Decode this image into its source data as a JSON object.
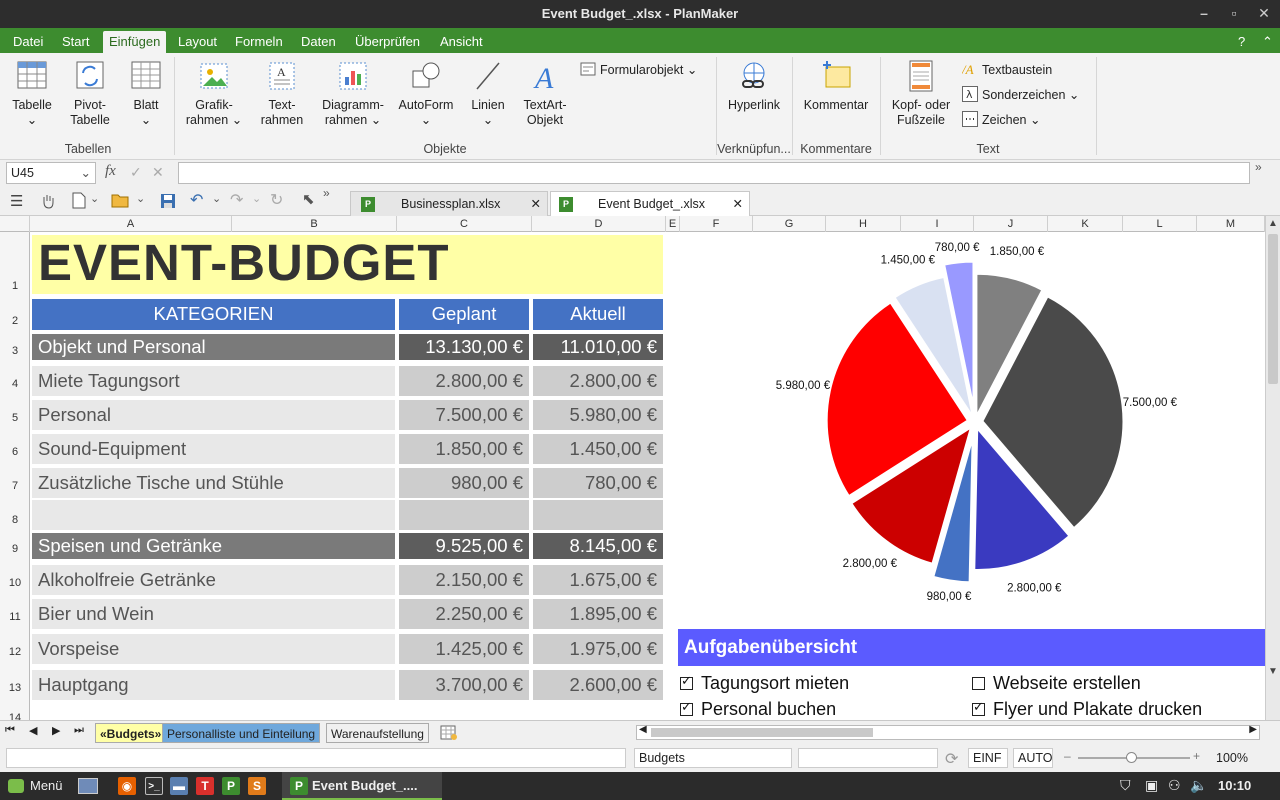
{
  "window": {
    "title": "Event Budget_.xlsx - PlanMaker"
  },
  "menu": {
    "tabs": [
      "Datei",
      "Start",
      "Einfügen",
      "Layout",
      "Formeln",
      "Daten",
      "Überprüfen",
      "Ansicht"
    ],
    "active": "Einfügen",
    "help": "?"
  },
  "ribbon": {
    "tabelle": "Tabelle",
    "pivot_1": "Pivot-",
    "pivot_2": "Tabelle",
    "blatt": "Blatt",
    "grafik_1": "Grafik-",
    "grafik_2": "rahmen",
    "text_1": "Text-",
    "text_2": "rahmen",
    "diagramm_1": "Diagramm-",
    "diagramm_2": "rahmen",
    "autoform": "AutoForm",
    "linien": "Linien",
    "textart_1": "TextArt-",
    "textart_2": "Objekt",
    "formularobjekt": "Formularobjekt",
    "hyperlink": "Hyperlink",
    "kommentar": "Kommentar",
    "kopf_1": "Kopf- oder",
    "kopf_2": "Fußzeile",
    "textbaustein": "Textbaustein",
    "sonderzeichen": "Sonderzeichen",
    "zeichen": "Zeichen",
    "groups": {
      "tabellen": "Tabellen",
      "objekte": "Objekte",
      "verknuepfungen": "Verknüpfun...",
      "kommentare": "Kommentare",
      "text": "Text"
    }
  },
  "formula_bar": {
    "cell_ref": "U45",
    "fx": "fx",
    "content": ""
  },
  "doc_tabs": [
    {
      "label": "Businessplan.xlsx"
    },
    {
      "label": "Event Budget_.xlsx"
    }
  ],
  "columns": [
    "A",
    "B",
    "C",
    "D",
    "E",
    "F",
    "G",
    "H",
    "I",
    "J",
    "K",
    "L",
    "M"
  ],
  "rows": [
    "1",
    "2",
    "3",
    "4",
    "5",
    "6",
    "7",
    "8",
    "9",
    "10",
    "11",
    "12",
    "13",
    "14"
  ],
  "sheet": {
    "title": "EVENT-BUDGET",
    "headers": {
      "kategorien": "KATEGORIEN",
      "geplant": "Geplant",
      "aktuell": "Aktuell"
    },
    "rows": [
      {
        "label": "Objekt und Personal",
        "geplant": "13.130,00 €",
        "aktuell": "11.010,00 €"
      },
      {
        "label": "Miete Tagungsort",
        "geplant": "2.800,00 €",
        "aktuell": "2.800,00 €"
      },
      {
        "label": "Personal",
        "geplant": "7.500,00 €",
        "aktuell": "5.980,00 €"
      },
      {
        "label": "Sound-Equipment",
        "geplant": "1.850,00 €",
        "aktuell": "1.450,00 €"
      },
      {
        "label": "Zusätzliche Tische und Stühle",
        "geplant": "980,00 €",
        "aktuell": "780,00 €"
      },
      {
        "label": "",
        "geplant": "",
        "aktuell": ""
      },
      {
        "label": "Speisen und Getränke",
        "geplant": "9.525,00 €",
        "aktuell": "8.145,00 €"
      },
      {
        "label": "Alkoholfreie Getränke",
        "geplant": "2.150,00 €",
        "aktuell": "1.675,00 €"
      },
      {
        "label": "Bier und Wein",
        "geplant": "2.250,00 €",
        "aktuell": "1.895,00 €"
      },
      {
        "label": "Vorspeise",
        "geplant": "1.425,00 €",
        "aktuell": "1.975,00 €"
      },
      {
        "label": "Hauptgang",
        "geplant": "3.700,00 €",
        "aktuell": "2.600,00 €"
      }
    ],
    "tasks_title": "Aufgabenübersicht",
    "tasks": [
      {
        "label": "Tagungsort mieten",
        "checked": true
      },
      {
        "label": "Webseite erstellen",
        "checked": false
      },
      {
        "label": "Personal buchen",
        "checked": true
      },
      {
        "label": "Flyer und Plakate drucken",
        "checked": true
      }
    ]
  },
  "chart_data": {
    "type": "pie",
    "title": "",
    "slices": [
      {
        "label": "1.850,00 €",
        "value": 1850,
        "color": "#808080"
      },
      {
        "label": "7.500,00 €",
        "value": 7500,
        "color": "#4a4a4a"
      },
      {
        "label": "2.800,00 €",
        "value": 2800,
        "color": "#3a3ac0"
      },
      {
        "label": "980,00 €",
        "value": 980,
        "color": "#4472c4"
      },
      {
        "label": "2.800,00 €",
        "value": 2800,
        "color": "#cc0000"
      },
      {
        "label": "5.980,00 €",
        "value": 5980,
        "color": "#ff0000"
      },
      {
        "label": "1.450,00 €",
        "value": 1450,
        "color": "#d9e1f2"
      },
      {
        "label": "780,00 €",
        "value": 780,
        "color": "#9999ff"
      }
    ]
  },
  "sheet_tabs": [
    {
      "label": "«Budgets»",
      "active": true
    },
    {
      "label": "Personalliste und Einteilung"
    },
    {
      "label": "Warenaufstellung"
    }
  ],
  "status": {
    "sheet": "Budgets",
    "einf": "EINF",
    "auto": "AUTO",
    "zoom": "100%"
  },
  "taskbar": {
    "menu": "Menü",
    "task": "Event Budget_....",
    "clock": "10:10"
  }
}
